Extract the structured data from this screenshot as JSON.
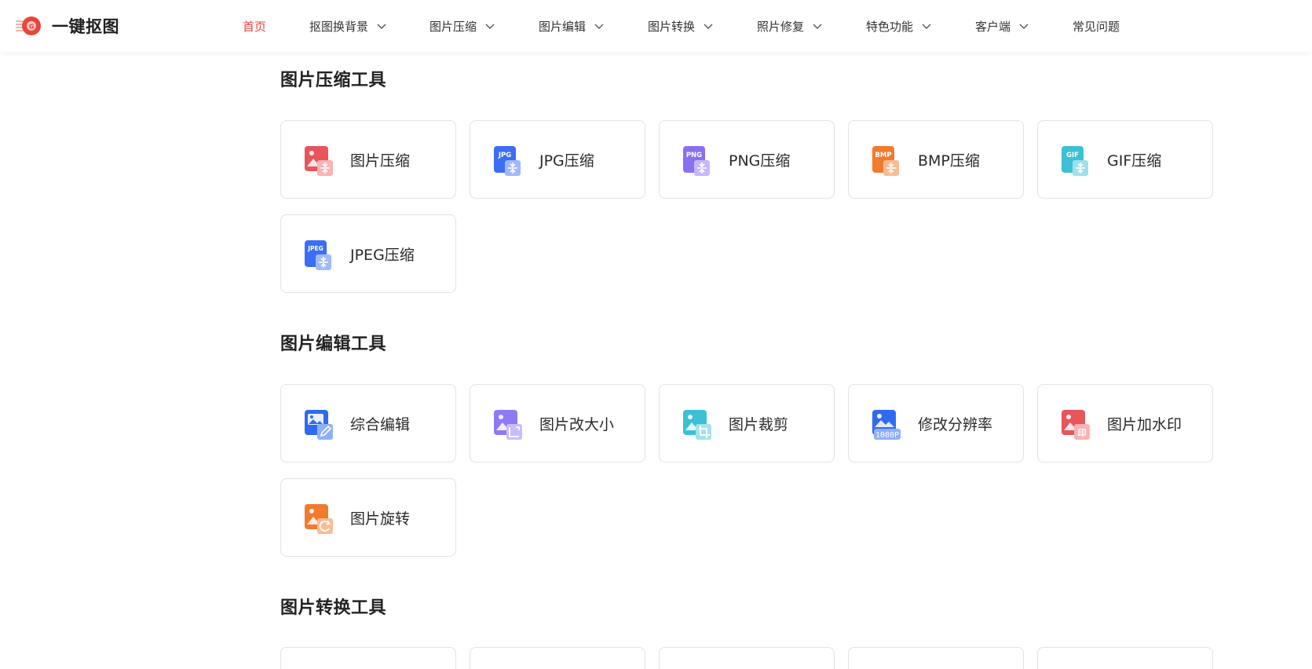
{
  "app": {
    "name": "一键抠图"
  },
  "nav": {
    "items": [
      {
        "label": "首页",
        "active": true,
        "dropdown": false
      },
      {
        "label": "抠图换背景",
        "dropdown": true
      },
      {
        "label": "图片压缩",
        "dropdown": true
      },
      {
        "label": "图片编辑",
        "dropdown": true
      },
      {
        "label": "图片转换",
        "dropdown": true
      },
      {
        "label": "照片修复",
        "dropdown": true
      },
      {
        "label": "特色功能",
        "dropdown": true
      },
      {
        "label": "客户端",
        "dropdown": true
      },
      {
        "label": "常见问题",
        "dropdown": false
      }
    ]
  },
  "sections": [
    {
      "title": "图片压缩工具",
      "tools": [
        {
          "label": "图片压缩",
          "icon": "image-compress-icon",
          "color": "#e8555a"
        },
        {
          "label": "JPG压缩",
          "icon": "jpg-compress-icon",
          "badge": "JPG",
          "color": "#3b6ef5"
        },
        {
          "label": "PNG压缩",
          "icon": "png-compress-icon",
          "badge": "PNG",
          "color": "#8b6ff2"
        },
        {
          "label": "BMP压缩",
          "icon": "bmp-compress-icon",
          "badge": "BMP",
          "color": "#f07a2e"
        },
        {
          "label": "GIF压缩",
          "icon": "gif-compress-icon",
          "badge": "GIF",
          "color": "#3cc0d4"
        },
        {
          "label": "JPEG压缩",
          "icon": "jpeg-compress-icon",
          "badge": "JPEG",
          "color": "#3b6ef5"
        }
      ]
    },
    {
      "title": "图片编辑工具",
      "tools": [
        {
          "label": "综合编辑",
          "icon": "edit-icon",
          "color": "#2f6af0"
        },
        {
          "label": "图片改大小",
          "icon": "resize-icon",
          "color": "#8f79f4"
        },
        {
          "label": "图片裁剪",
          "icon": "crop-icon",
          "color": "#3cc0d4"
        },
        {
          "label": "修改分辨率",
          "icon": "resolution-icon",
          "badge": "1080P",
          "color": "#2f6af0"
        },
        {
          "label": "图片加水印",
          "icon": "watermark-icon",
          "badge": "印",
          "color": "#e8555a"
        },
        {
          "label": "图片旋转",
          "icon": "rotate-icon",
          "color": "#f07a2e"
        }
      ]
    },
    {
      "title": "图片转换工具",
      "tools": []
    }
  ]
}
